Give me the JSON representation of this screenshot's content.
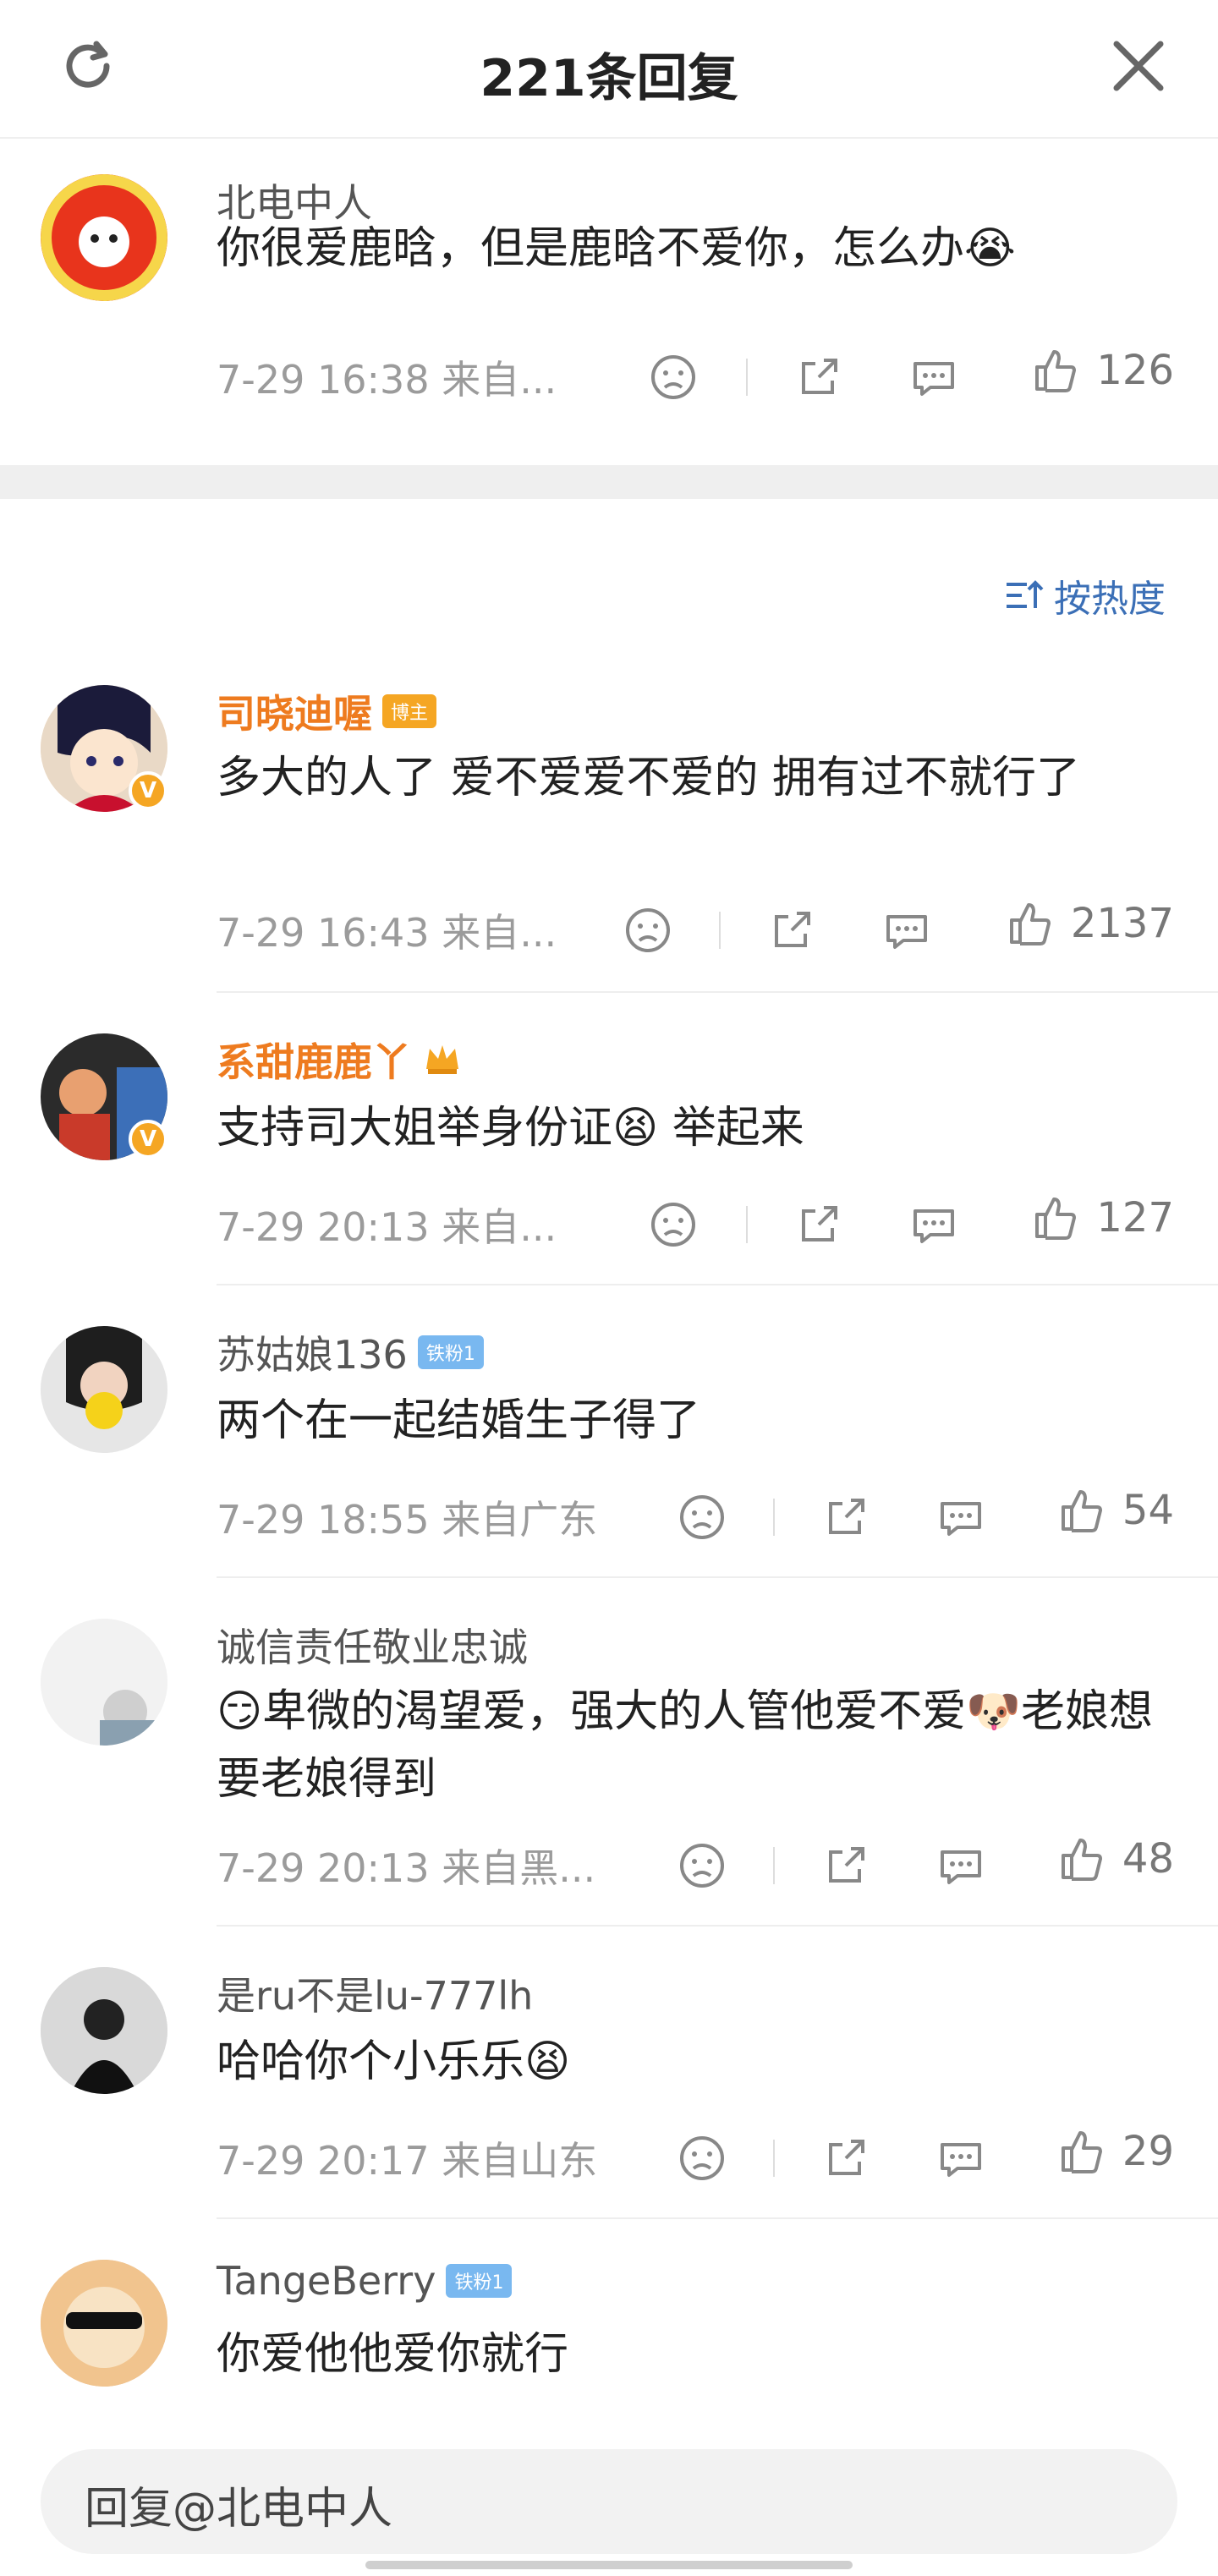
{
  "header": {
    "title": "221条回复",
    "refresh_icon": "refresh-icon",
    "close_icon": "close-icon"
  },
  "root": {
    "name": "北电中人",
    "text": "你很爱鹿晗，但是鹿晗不爱你，怎么办😭",
    "time": "7-29 16:38 来自...",
    "likes": "126"
  },
  "sort": {
    "label": "按热度"
  },
  "comments": [
    {
      "name": "司晓迪喔",
      "tag": "博主",
      "text": "多大的人了 爱不爱爱不爱的 拥有过不就行了",
      "time": "7-29 16:43 来自...",
      "likes": "2137"
    },
    {
      "name": "系甜鹿鹿丫",
      "text": "支持司大姐举身份证😫 举起来",
      "time": "7-29 20:13 来自...",
      "likes": "127"
    },
    {
      "name": "苏姑娘136",
      "badge": "铁粉1",
      "text": "两个在一起结婚生子得了",
      "time": "7-29 18:55 来自广东",
      "likes": "54"
    },
    {
      "name": "诚信责任敬业忠诚",
      "text": "😏卑微的渴望爱，强大的人管他爱不爱🐶老娘想要老娘得到",
      "time": "7-29 20:13 来自黑...",
      "likes": "48"
    },
    {
      "name": "是ru不是lu-777lh",
      "text": "哈哈你个小乐乐😫",
      "time": "7-29 20:17 来自山东",
      "likes": "29"
    },
    {
      "name": "TangeBerry",
      "badge": "铁粉1",
      "text": "你爱他他爱你就行"
    }
  ],
  "reply": {
    "placeholder": "回复@北电中人"
  },
  "colors": {
    "accent": "#ee7b1f",
    "link": "#3b6fb6",
    "vbadge": "#f5a623"
  }
}
